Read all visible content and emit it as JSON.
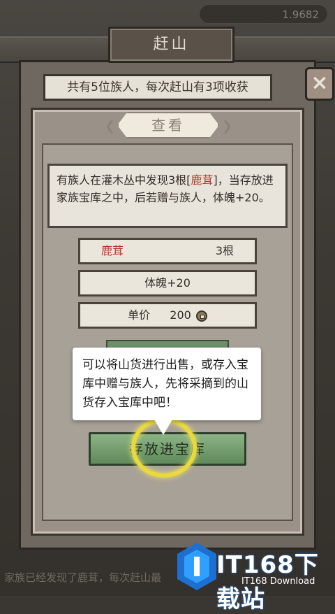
{
  "header": {
    "currency_value": "1.9682",
    "title": "赶山"
  },
  "info_bar": {
    "text": "共有5位族人，每次赶山有3项收获"
  },
  "close_button": {
    "label": "×"
  },
  "panel": {
    "header": "查看",
    "description_part1": "有族人在灌木丛中发现3根[",
    "description_highlight": "鹿茸",
    "description_part2": "]，当存放进家族宝库之中，后若赠与族人，体魄+20。"
  },
  "item_row": {
    "name": "鹿茸",
    "quantity": "3根"
  },
  "effect_row": {
    "text": "体魄+20"
  },
  "price_row": {
    "label": "单价",
    "value": "200",
    "icon": "coin-icon"
  },
  "tooltip": {
    "text": "可以将山货进行出售，或存入宝库中赠与族人，先将采摘到的山货存入宝库中吧！"
  },
  "store_button": {
    "label": "存放进宝库"
  },
  "bottom_caption": {
    "text": "家族已经发现了鹿茸，每次赶山最"
  },
  "watermark": {
    "title": "IT168下载站",
    "subtitle": "IT168 Download"
  },
  "colors": {
    "highlight_text": "#b23a2c",
    "button_green": "#6e9a68",
    "ring_yellow": "#e9d93b"
  }
}
